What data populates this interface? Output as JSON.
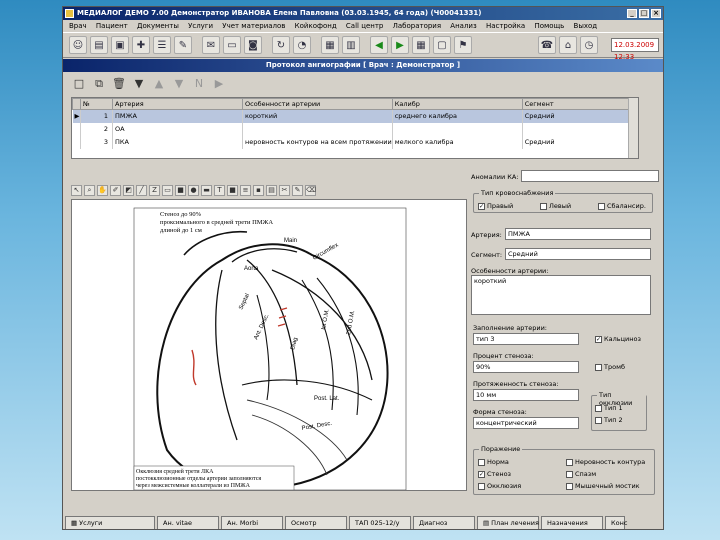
{
  "window": {
    "title": "МЕДИАЛОГ ДЕМО 7.00   Демонстратор   ИВАНОВА Елена Павловна (03.03.1945, 64 года) (Ч00041331)"
  },
  "menu": {
    "items": [
      "Врач",
      "Пациент",
      "Документы",
      "Услуги",
      "Учет материалов",
      "Койкофонд",
      "Call центр",
      "Лаборатория",
      "Анализ",
      "Настройка",
      "Помощь",
      "Выход"
    ]
  },
  "toolbar": {
    "date_value": "12.03.2009 12:33"
  },
  "form": {
    "header": "Протокол ангиографии   [ Врач : Демонстратор ]",
    "grid_nav_label": "N"
  },
  "grid": {
    "columns": [
      "№",
      "Артерия",
      "Особенности артерии",
      "Калибр",
      "Сегмент"
    ],
    "rows": [
      {
        "num": "1",
        "artery": "ПМЖА",
        "feature": "короткий",
        "caliber": "среднего калибра",
        "segment": "Средний"
      },
      {
        "num": "2",
        "artery": "ОА",
        "feature": "",
        "caliber": "",
        "segment": ""
      },
      {
        "num": "3",
        "artery": "ПКА",
        "feature": "неровность контуров на всем протяжении",
        "caliber": "мелкого калибра",
        "segment": "Средний"
      }
    ]
  },
  "diagram": {
    "annotation_top": [
      "Стеноз до 90%",
      "проксимального в средней трети ПМЖА",
      "длиной до 1 см"
    ],
    "annotation_bottom": [
      "Окклюзия средней трети ЛКА",
      "постокклюзионные отделы артерии заполняются",
      "через межсистемные коллатерали из ПМЖА"
    ],
    "labels": {
      "aorta": "Aorta",
      "main": "Main",
      "circumflex": "Circumflex",
      "septal": "Septal",
      "ant_desc": "Ant. Desc.",
      "diag": "Diag",
      "ist_om": "Ist O.M.",
      "om2": "2nd O.M.",
      "post_lat": "Post. Lat.",
      "post_desc": "Post. Desc."
    }
  },
  "details": {
    "anomaly_label": "Аномалии КА:",
    "anomaly_value": "",
    "blood_supply_title": "Тип кровоснабжения",
    "blood_supply_options": [
      {
        "label": "Правый",
        "checked": true
      },
      {
        "label": "Левый",
        "checked": false
      },
      {
        "label": "Сбалансир.",
        "checked": false
      }
    ],
    "artery_label": "Артерия:",
    "artery_value": "ПМЖА",
    "segment_label": "Сегмент:",
    "segment_value": "Средний",
    "features_label": "Особенности артерии:",
    "features_value": "короткий",
    "lesion_title": "Заполнение артерии:",
    "lesion_value": "тип 3",
    "calcinosis_label": "Кальциноз",
    "calcinosis_checked": true,
    "stenosis_pct_label": "Процент стеноза:",
    "stenosis_pct_value": "90%",
    "thrombus_label": "Тромб",
    "thrombus_checked": false,
    "stenosis_len_label": "Протяженность стеноза:",
    "stenosis_len_value": "10 мм",
    "occlusion_type_title": "Тип окклюзии",
    "occlusion_types": [
      {
        "label": "Тип 1",
        "checked": false
      },
      {
        "label": "Тип 2",
        "checked": false
      }
    ],
    "stenosis_form_label": "Форма стеноза:",
    "stenosis_form_value": "концентрический",
    "lesion_group_title": "Поражение",
    "lesion_options": [
      {
        "label": "Норма",
        "checked": false
      },
      {
        "label": "Неровность контура",
        "checked": false
      },
      {
        "label": "Стеноз",
        "checked": true
      },
      {
        "label": "Спазм",
        "checked": false
      },
      {
        "label": "Окклюзия",
        "checked": false
      },
      {
        "label": "Мышечный мостик",
        "checked": false
      }
    ]
  },
  "bottom_tabs": [
    "Услуги",
    "Ан. vitae",
    "Ан. Morbi",
    "Осмотр",
    "ТАП 025-12/у",
    "Диагноз",
    "План лечения",
    "Назначения",
    "Конс"
  ]
}
